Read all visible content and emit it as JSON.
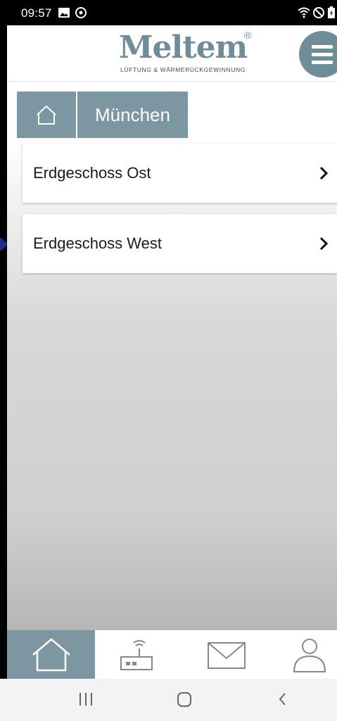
{
  "status_bar": {
    "time": "09:57",
    "left_icons": [
      "image-icon",
      "sync-icon"
    ],
    "right_icons": [
      "wifi-icon",
      "dnd-icon",
      "battery-icon"
    ]
  },
  "header": {
    "logo_text": "Meltem",
    "logo_registered": "®",
    "logo_tagline": "LÜFTUNG & WÄRMERÜCKGEWINNUNG",
    "menu_icon": "hamburger-icon"
  },
  "breadcrumb": {
    "home_icon": "home-icon",
    "current": "München"
  },
  "locations": [
    {
      "label": "Erdgeschoss Ost"
    },
    {
      "label": "Erdgeschoss West"
    }
  ],
  "bottom_nav": {
    "tabs": [
      {
        "icon": "home-icon",
        "active": true
      },
      {
        "icon": "router-icon",
        "active": false
      },
      {
        "icon": "mail-icon",
        "active": false
      },
      {
        "icon": "user-icon",
        "active": false
      }
    ]
  },
  "colors": {
    "brand": "#6f8c99",
    "breadcrumb_bg": "#7c97a2",
    "indicator_arrow": "#1f2a8a"
  }
}
